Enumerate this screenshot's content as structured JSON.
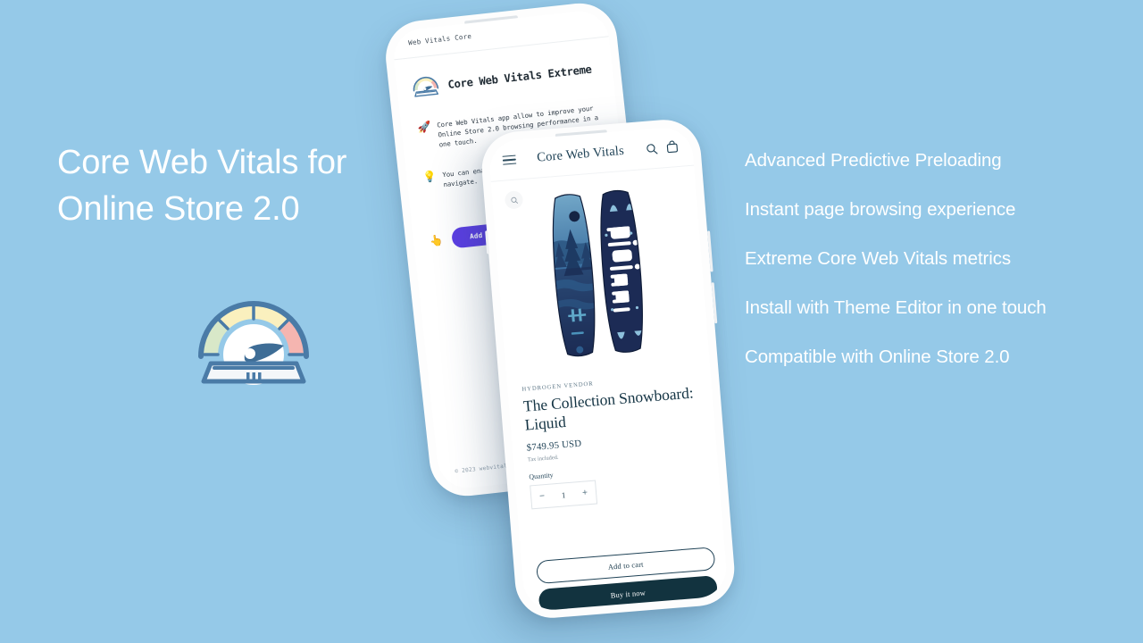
{
  "colors": {
    "background": "#95c9e8",
    "headline_text": "#ffffff",
    "gauge_outline": "#4a7ba7",
    "gauge_green": "#d8e8c8",
    "gauge_yellow": "#faf0be",
    "gauge_red": "#f5b5b0",
    "gauge_needle": "#3e6d96",
    "accent_purple": "#5c3fe4",
    "store_dark": "#12333f"
  },
  "hero": {
    "headline_line1": "Core Web Vitals for",
    "headline_line2": "Online Store 2.0",
    "logo_icon": "speedometer-gauge-icon"
  },
  "features": [
    "Advanced Predictive Preloading",
    "Instant page browsing experience",
    "Extreme Core Web Vitals metrics",
    "Install with Theme Editor in one touch",
    "Compatible with Online Store 2.0"
  ],
  "app_phone": {
    "header_title": "Web Vitals Core",
    "app_title": "Core Web Vitals Extreme",
    "logo_icon": "speedometer-gauge-icon",
    "bullets": [
      {
        "icon": "rocket-icon",
        "glyph": "🚀",
        "text": "Core Web Vitals app allow to improve your Online Store 2.0 browsing performance in a one touch."
      },
      {
        "icon": "lightbulb-icon",
        "glyph": "💡",
        "text": "You can enable/disab theme editor provide yo navigate."
      }
    ],
    "add_app": {
      "icon": "hand-tap-icon",
      "glyph": "👆",
      "label": "Add app"
    },
    "footer": "© 2023 webvitalsco"
  },
  "store_phone": {
    "header": {
      "menu_icon": "hamburger-menu-icon",
      "store_name": "Core Web Vitals",
      "search_icon": "search-icon",
      "cart_icon": "shopping-bag-icon"
    },
    "gallery": {
      "zoom_icon": "zoom-in-icon",
      "product_image_alt": "snowboard-pair-liquid"
    },
    "product": {
      "vendor": "HYDROGEN VENDOR",
      "title": "The Collection Snowboard: Liquid",
      "price": "$749.95 USD",
      "tax_note": "Tax included.",
      "quantity_label": "Quantity",
      "quantity_decrement": "−",
      "quantity_value": "1",
      "quantity_increment": "+"
    },
    "actions": {
      "add_to_cart": "Add to cart",
      "buy_it_now": "Buy it now"
    }
  }
}
